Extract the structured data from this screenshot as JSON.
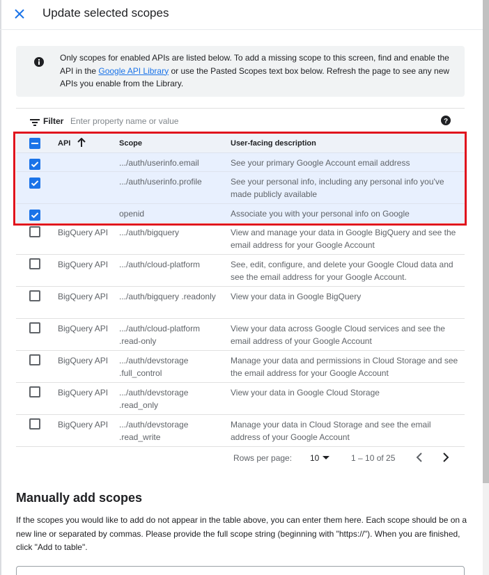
{
  "header": {
    "title": "Update selected scopes"
  },
  "info": {
    "text_before": "Only scopes for enabled APIs are listed below. To add a missing scope to this screen, find and enable the API in the ",
    "link": "Google API Library",
    "text_after": " or use the Pasted Scopes text box below. Refresh the page to see any new APIs you enable from the Library."
  },
  "filter": {
    "label": "Filter",
    "placeholder": "Enter property name or value"
  },
  "table": {
    "columns": {
      "api": "API",
      "scope": "Scope",
      "description": "User-facing description"
    },
    "rows": [
      {
        "checked": true,
        "api": "",
        "scope": ".../auth/userinfo.email",
        "description": "See your primary Google Account email address"
      },
      {
        "checked": true,
        "api": "",
        "scope": ".../auth/userinfo.profile",
        "description": "See your personal info, including any personal info you've made publicly available"
      },
      {
        "checked": true,
        "api": "",
        "scope": "openid",
        "description": "Associate you with your personal info on Google"
      },
      {
        "checked": false,
        "api": "BigQuery API",
        "scope": ".../auth/bigquery",
        "description": "View and manage your data in Google BigQuery and see the email address for your Google Account"
      },
      {
        "checked": false,
        "api": "BigQuery API",
        "scope": ".../auth/cloud-platform",
        "description": "See, edit, configure, and delete your Google Cloud data and see the email address for your Google Account."
      },
      {
        "checked": false,
        "api": "BigQuery API",
        "scope": ".../auth/bigquery .readonly",
        "description": "View your data in Google BigQuery"
      },
      {
        "checked": false,
        "api": "BigQuery API",
        "scope": ".../auth/cloud-platform .read-only",
        "description": "View your data across Google Cloud services and see the email address of your Google Account"
      },
      {
        "checked": false,
        "api": "BigQuery API",
        "scope": ".../auth/devstorage .full_control",
        "description": "Manage your data and permissions in Cloud Storage and see the email address for your Google Account"
      },
      {
        "checked": false,
        "api": "BigQuery API",
        "scope": ".../auth/devstorage .read_only",
        "description": "View your data in Google Cloud Storage"
      },
      {
        "checked": false,
        "api": "BigQuery API",
        "scope": ".../auth/devstorage .read_write",
        "description": "Manage your data in Cloud Storage and see the email address of your Google Account"
      }
    ]
  },
  "pagination": {
    "rows_label": "Rows per page:",
    "rows_value": "10",
    "range": "1 – 10 of 25"
  },
  "manual": {
    "title": "Manually add scopes",
    "text": "If the scopes you would like to add do not appear in the table above, you can enter them here. Each scope should be on a new line or separated by commas. Please provide the full scope string (beginning with \"https://\"). When you are finished, click \"Add to table\"."
  },
  "colors": {
    "accent": "#1a73e8",
    "highlight": "#e0141e",
    "selected_row": "#e8f0fe"
  },
  "icons": [
    "close-icon",
    "info-icon",
    "filter-icon",
    "help-icon",
    "sort-arrow-icon",
    "chevron-left-icon",
    "chevron-right-icon"
  ]
}
